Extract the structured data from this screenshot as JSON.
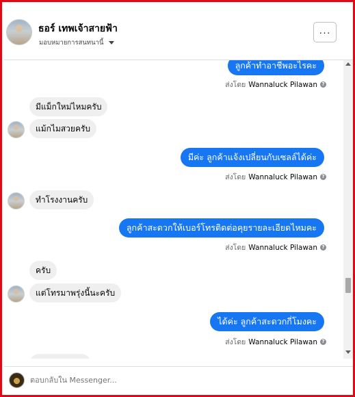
{
  "header": {
    "page_name": "ธอร์ เทพเจ้าสายฟ้า",
    "assignment": "มอบหมายการสนทนานี้",
    "more_label": "···"
  },
  "messages": [
    {
      "side": "out",
      "text": "ลูกค้าทำอาชีพอะไรคะ"
    },
    {
      "side": "meta",
      "prefix": "ส่งโดย",
      "sender": "Wannaluck Pilawan"
    },
    {
      "side": "in",
      "text": "มีแม็กใหม่ไหมครับ"
    },
    {
      "side": "in",
      "text": "แม้กไมสวยครับ"
    },
    {
      "side": "out",
      "text": "มีค่ะ ลูกค้าแจ้งเปลี่ยนกับเซลล์ได้ค่ะ"
    },
    {
      "side": "meta",
      "prefix": "ส่งโดย",
      "sender": "Wannaluck Pilawan"
    },
    {
      "side": "in",
      "text": "ทำโรงงานครับ"
    },
    {
      "side": "out",
      "text": "ลูกค้าสะดวกให้เบอร์โทรติดต่อคุยรายละเอียดไหมคะ"
    },
    {
      "side": "meta",
      "prefix": "ส่งโดย",
      "sender": "Wannaluck Pilawan"
    },
    {
      "side": "in",
      "text": "ครับ"
    },
    {
      "side": "in",
      "text": "แต่โทรมาพรุ่งนี้นะครับ"
    },
    {
      "side": "out",
      "text": "ได้ค่ะ ลูกค้าสะดวกกี่โมงคะ"
    },
    {
      "side": "meta",
      "prefix": "ส่งโดย",
      "sender": "Wannaluck Pilawan"
    }
  ],
  "composer": {
    "placeholder": "ตอบกลับใน Messenger..."
  },
  "colors": {
    "outgoing_bubble": "#1777f2",
    "incoming_bubble": "#efefef",
    "frame_border": "#e30613"
  },
  "icons": {
    "more": "more-icon",
    "seen": "info-icon",
    "caret": "chevron-down-icon"
  }
}
